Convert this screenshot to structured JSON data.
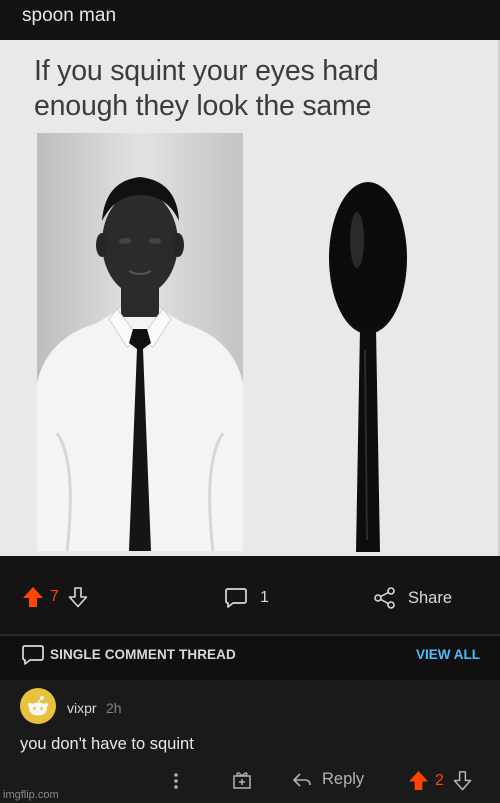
{
  "post": {
    "title": "spoon man",
    "meme_caption": "If you squint your eyes hard enough they look the same"
  },
  "actions": {
    "upvote_icon": "upvote-arrow-icon",
    "vote_count": "7",
    "downvote_icon": "downvote-arrow-icon",
    "comment_icon": "comment-bubble-icon",
    "comment_count": "1",
    "share_icon": "share-icon",
    "share_label": "Share"
  },
  "thread": {
    "label": "SINGLE COMMENT THREAD",
    "view_all": "VIEW ALL"
  },
  "comment": {
    "username": "vixpr",
    "time": "2h",
    "body": "you don't have to squint",
    "reply_label": "Reply",
    "vote_count": "2"
  },
  "watermark": "imgflip.com",
  "colors": {
    "upvote": "#ff4500",
    "link": "#4fbcff",
    "avatar": "#e8c23c"
  }
}
